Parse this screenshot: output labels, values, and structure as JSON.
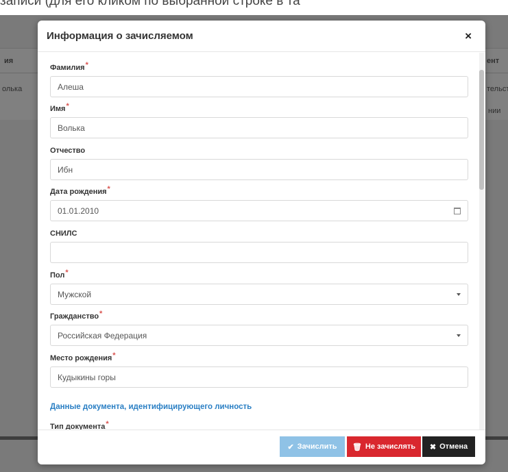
{
  "background": {
    "caption": "записи (для его кликом по выбранной строке в та",
    "table_headers": [
      "ия",
      "ент"
    ],
    "cells": [
      "олька",
      "тельст",
      "нии"
    ]
  },
  "modal": {
    "title": "Информация о зачисляемом",
    "close_glyph": "×",
    "required_mark": "*",
    "fields": [
      {
        "label": "Фамилия",
        "value": "Алеша",
        "required": true
      },
      {
        "label": "Имя",
        "value": "Волька",
        "required": true
      },
      {
        "label": "Отчество",
        "value": "Ибн",
        "required": false
      },
      {
        "label": "Дата рождения",
        "value": "01.01.2010",
        "required": true,
        "icon": "calendar-icon"
      },
      {
        "label": "СНИЛС",
        "value": "",
        "required": false
      },
      {
        "label": "Пол",
        "value": "Мужской",
        "required": true,
        "icon": "chevron-down-icon"
      },
      {
        "label": "Гражданство",
        "value": "Российская Федерация",
        "required": true,
        "icon": "chevron-down-icon"
      },
      {
        "label": "Место рождения",
        "value": "Кудыкины горы",
        "required": true
      }
    ],
    "section_title": "Данные документа, идентифицирующего личность",
    "doc_type_label": "Тип документа",
    "buttons": {
      "enroll": "Зачислить",
      "reject": "Не зачислять",
      "cancel": "Отмена"
    },
    "colors": {
      "accent": "#2a7fc4",
      "enroll": "#8fc2e6",
      "reject": "#d9272e",
      "cancel": "#222222",
      "required": "#d9534f"
    }
  }
}
